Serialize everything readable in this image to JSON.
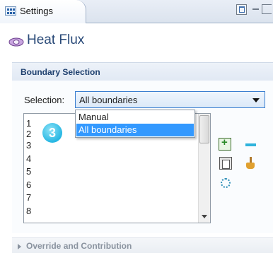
{
  "tab": {
    "label": "Settings",
    "icon": "settings-grid-icon"
  },
  "window_controls": [
    "maximize-icon",
    "minimize-icon",
    "restore-icon"
  ],
  "page": {
    "title": "Heat Flux",
    "icon": "heat-flux-icon"
  },
  "boundary_selection": {
    "title": "Boundary Selection",
    "selection_label": "Selection:",
    "selection_value": "All boundaries",
    "options": [
      {
        "label": "Manual",
        "selected": false
      },
      {
        "label": "All boundaries",
        "selected": true
      }
    ],
    "list_items": [
      "1",
      "2",
      "3",
      "4",
      "5",
      "6",
      "7",
      "8"
    ],
    "badge": "3",
    "accent_color": "#3399ff"
  },
  "collapsed_section": {
    "title": "Override and Contribution"
  },
  "toolbar_icons": [
    "add-to-selection-icon",
    "remove-from-selection-icon",
    "paste-selection-icon",
    "clear-selection-icon",
    "zoom-to-selection-icon"
  ]
}
